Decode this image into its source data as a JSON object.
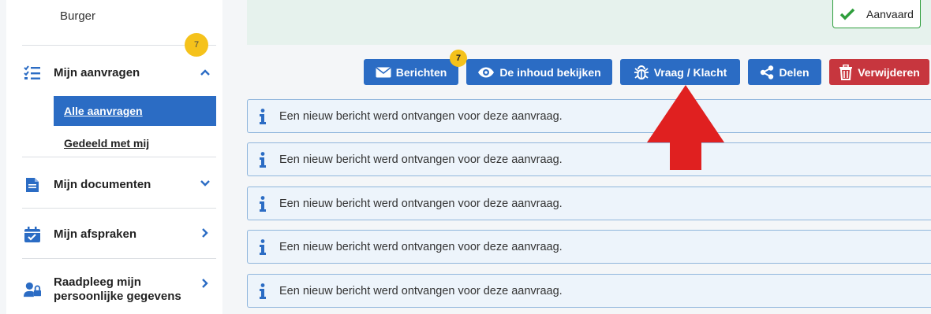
{
  "sidebar": {
    "top_label": "Burger",
    "badge_count": "7",
    "items": [
      {
        "label": "Mijn aanvragen",
        "icon": "list-check-icon"
      },
      {
        "label": "Mijn documenten",
        "icon": "document-icon"
      },
      {
        "label": "Mijn afspraken",
        "icon": "calendar-check-icon"
      },
      {
        "label_line1": "Raadpleeg mijn",
        "label_line2": "persoonlijke gegevens",
        "icon": "user-lock-icon"
      }
    ],
    "subitems": [
      {
        "label": "Alle aanvragen",
        "active": true
      },
      {
        "label": "Gedeeld met mij",
        "active": false
      }
    ]
  },
  "status": {
    "label": "Aanvaard",
    "color": "#2e9e3c"
  },
  "toolbar": {
    "messages_label": "Berichten",
    "messages_badge": "7",
    "view_label": "De inhoud bekijken",
    "question_label": "Vraag / Klacht",
    "share_label": "Delen",
    "delete_label": "Verwijderen"
  },
  "messages": [
    "Een nieuw bericht werd ontvangen voor deze aanvraag.",
    "Een nieuw bericht werd ontvangen voor deze aanvraag.",
    "Een nieuw bericht werd ontvangen voor deze aanvraag.",
    "Een nieuw bericht werd ontvangen voor deze aanvraag.",
    "Een nieuw bericht werd ontvangen voor deze aanvraag."
  ],
  "colors": {
    "primary": "#2b6cc4",
    "danger": "#c7363e",
    "badge": "#f5c21b",
    "arrow": "#e02020"
  }
}
